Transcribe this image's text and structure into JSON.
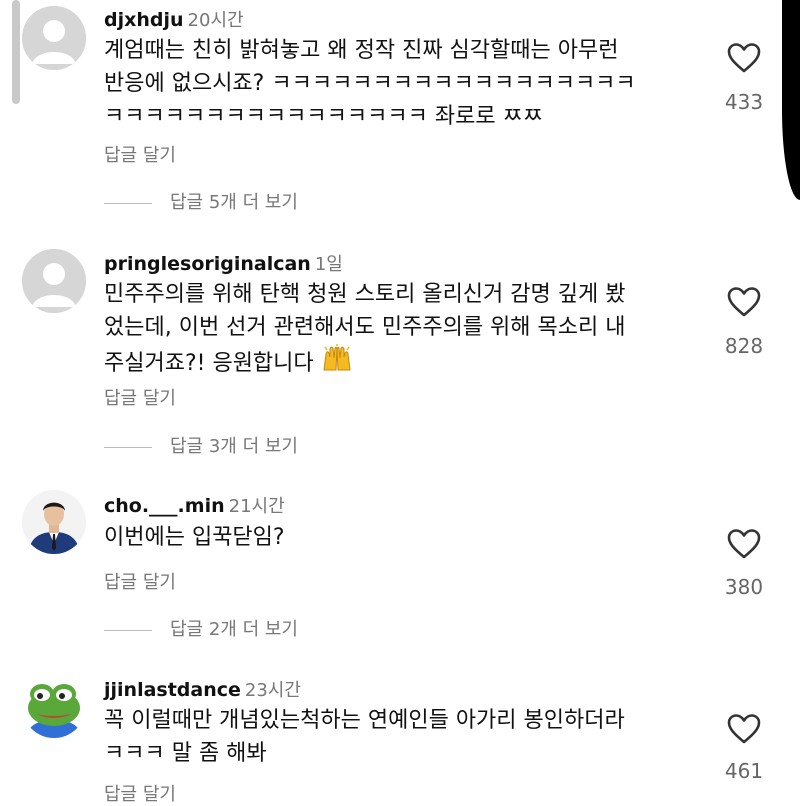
{
  "comments": [
    {
      "username": "djxhdju",
      "time": "20시간",
      "text": "계엄때는 친히 밝혀놓고 왜 정작 진짜 심각할때는 아무런\n반응에 없으시죠? ㅋㅋㅋㅋㅋㅋㅋㅋㅋㅋㅋㅋㅋㅋㅋㅋㅋㅋ\nㅋㅋㅋㅋㅋㅋㅋㅋㅋㅋㅋㅋㅋㅋㅋㅋ 좌로로 ㅉㅉ",
      "reply_label": "답글 달기",
      "more_replies": "답글 5개 더 보기",
      "likes": "433",
      "avatar": "default-avatar-icon"
    },
    {
      "username": "pringlesoriginalcan",
      "time": "1일",
      "text": "민주주의를 위해 탄핵 청원 스토리 올리신거 감명 깊게 봤\n었는데, 이번 선거 관련해서도 민주주의를 위해 목소리 내\n주실거죠?! 응원합니다",
      "emoji": "raising-hands-emoji",
      "reply_label": "답글 달기",
      "more_replies": "답글 3개 더 보기",
      "likes": "828",
      "avatar": "default-avatar-icon"
    },
    {
      "username": "cho.___.min",
      "time": "21시간",
      "text": "이번에는 입꾹닫임?",
      "reply_label": "답글 달기",
      "more_replies": "답글 2개 더 보기",
      "likes": "380",
      "avatar": "person-photo-avatar"
    },
    {
      "username": "jjinlastdance",
      "time": "23시간",
      "text": "꼭 이럴때만 개념있는척하는 연예인들 아가리 봉인하더라\nㅋㅋㅋ 말 좀 해봐",
      "reply_label": "답글 달기",
      "likes": "461",
      "avatar": "frog-avatar"
    }
  ],
  "colors": {
    "text": "#111111",
    "muted": "#777777",
    "like_count": "#666666"
  }
}
